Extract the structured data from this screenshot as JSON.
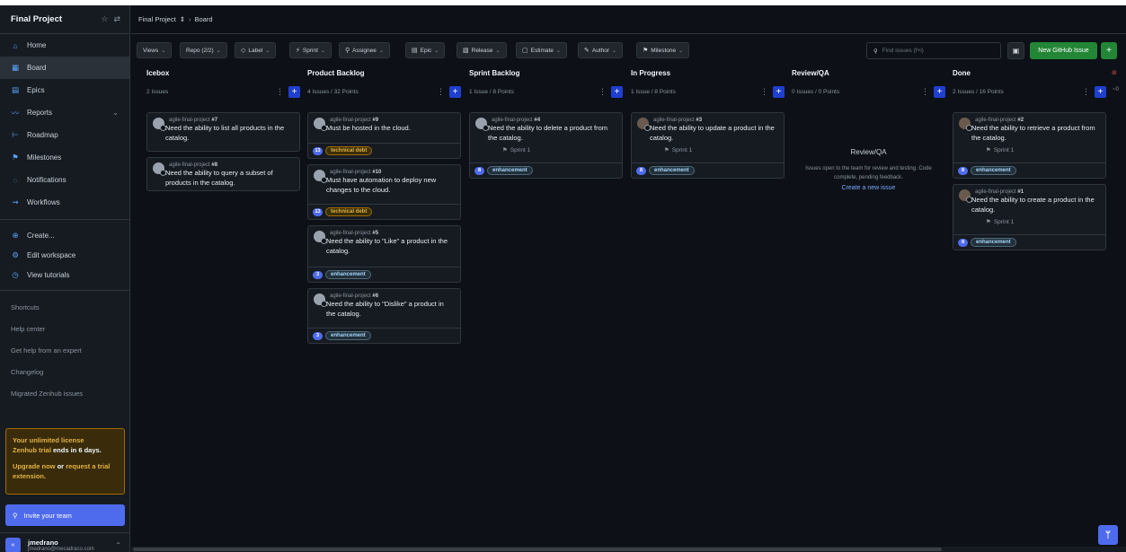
{
  "sidebar": {
    "title": "Final Project",
    "items": [
      {
        "label": "Home",
        "icon": "home-icon",
        "glyph": "⌂"
      },
      {
        "label": "Board",
        "icon": "board-icon",
        "glyph": "▦"
      },
      {
        "label": "Epics",
        "icon": "epic-icon",
        "glyph": "▤"
      },
      {
        "label": "Reports",
        "icon": "reports-icon",
        "glyph": "〰"
      },
      {
        "label": "Roadmap",
        "icon": "roadmap-icon",
        "glyph": "⊢"
      },
      {
        "label": "Milestones",
        "icon": "milestone-icon",
        "glyph": "⚑"
      },
      {
        "label": "Notifications",
        "icon": "bell-icon",
        "glyph": "◌"
      },
      {
        "label": "Workflows",
        "icon": "workflow-icon",
        "glyph": "⇝"
      }
    ],
    "actions": [
      {
        "label": "Create...",
        "icon": "plus-circle-icon",
        "glyph": "⊕"
      },
      {
        "label": "Edit workspace",
        "icon": "settings-icon",
        "glyph": "⚙"
      },
      {
        "label": "View tutorials",
        "icon": "play-icon",
        "glyph": "◷"
      }
    ],
    "links": [
      "Shortcuts",
      "Help center",
      "Get help from an expert",
      "Changelog",
      "Migrated Zenhub issues"
    ],
    "trial": {
      "line1": "Your unlimited license",
      "line2a": "Zenhub trial ",
      "line2b": "ends in 6 days.",
      "upgrade": "Upgrade now",
      "or": " or ",
      "request": "request a trial extension."
    },
    "invite": "Invite your team",
    "user": {
      "name": "jmedrano",
      "email": "jmedrano@mecadraco.com"
    }
  },
  "breadcrumb": {
    "project": "Final Project",
    "current": "Board"
  },
  "toolbar": {
    "filters": [
      {
        "label": "Views",
        "icon": ""
      },
      {
        "label": "Repo (2/2)",
        "icon": ""
      },
      {
        "label": "Label",
        "icon": "◇"
      },
      {
        "label": "Sprint",
        "icon": "⚡"
      },
      {
        "label": "Assignee",
        "icon": "⚲"
      },
      {
        "label": "Epic",
        "icon": "▤"
      },
      {
        "label": "Release",
        "icon": "▧"
      },
      {
        "label": "Estimate",
        "icon": "▢"
      },
      {
        "label": "Author",
        "icon": "✎"
      },
      {
        "label": "Milestone",
        "icon": "⚑"
      }
    ],
    "search_placeholder": "Find issues (f+i)",
    "new_issue": "New GitHub Issue"
  },
  "columns": [
    {
      "title": "Icebox",
      "meta": "2 Issues",
      "cards": [
        {
          "repo": "agile-final-project",
          "num": "#7",
          "title": "Need the ability to list all products in the catalog.",
          "sprint": "",
          "points": "",
          "label": "",
          "label_type": "",
          "avatar": "default"
        },
        {
          "repo": "agile-final-project",
          "num": "#8",
          "title": "Need the ability to query a subset of products in the catalog.",
          "sprint": "",
          "points": "",
          "label": "",
          "label_type": "",
          "avatar": "default"
        }
      ]
    },
    {
      "title": "Product Backlog",
      "meta": "4 Issues / 32 Points",
      "cards": [
        {
          "repo": "agile-final-project",
          "num": "#9",
          "title": "Must be hosted in the cloud.",
          "sprint": "",
          "points": "13",
          "label": "technical debt",
          "label_type": "td",
          "avatar": "default"
        },
        {
          "repo": "agile-final-project",
          "num": "#10",
          "title": "Must have automation to deploy new changes to the cloud.",
          "sprint": "",
          "points": "13",
          "label": "technical debt",
          "label_type": "td",
          "avatar": "default"
        },
        {
          "repo": "agile-final-project",
          "num": "#5",
          "title": "Need the ability to \"Like\" a product in the catalog.",
          "sprint": "",
          "points": "3",
          "label": "enhancement",
          "label_type": "en",
          "avatar": "default"
        },
        {
          "repo": "agile-final-project",
          "num": "#6",
          "title": "Need the ability to \"Dislike\" a product in the catalog.",
          "sprint": "",
          "points": "3",
          "label": "enhancement",
          "label_type": "en",
          "avatar": "default"
        }
      ]
    },
    {
      "title": "Sprint Backlog",
      "meta": "1 Issue / 8 Points",
      "cards": [
        {
          "repo": "agile-final-project",
          "num": "#4",
          "title": "Need the ability to delete a product from the catalog.",
          "sprint": "Sprint 1",
          "points": "8",
          "label": "enhancement",
          "label_type": "en",
          "avatar": "default"
        }
      ]
    },
    {
      "title": "In Progress",
      "meta": "1 Issue / 8 Points",
      "cards": [
        {
          "repo": "agile-final-project",
          "num": "#3",
          "title": "Need the ability to update a product in the catalog.",
          "sprint": "Sprint 1",
          "points": "8",
          "label": "enhancement",
          "label_type": "en",
          "avatar": "photo"
        }
      ]
    },
    {
      "title": "Review/QA",
      "meta": "0 Issues / 0 Points",
      "cards": [],
      "empty": {
        "title": "Review/QA",
        "desc": "Issues open to the team for review and testing. Code complete, pending feedback.",
        "action": "Create a new issue"
      }
    },
    {
      "title": "Done",
      "meta": "2 Issues / 16 Points",
      "cards": [
        {
          "repo": "agile-final-project",
          "num": "#2",
          "title": "Need the ability to retrieve a product from the catalog.",
          "sprint": "Sprint 1",
          "points": "8",
          "label": "enhancement",
          "label_type": "en",
          "avatar": "photo"
        },
        {
          "repo": "agile-final-project",
          "num": "#1",
          "title": "Need the ability to create a product in the catalog.",
          "sprint": "Sprint 1",
          "points": "8",
          "label": "enhancement",
          "label_type": "en",
          "avatar": "photo"
        }
      ]
    }
  ],
  "edge": {
    "more": "~0"
  },
  "colors": {
    "accent": "#4f6bed",
    "green": "#238636",
    "warning": "#e3b341"
  }
}
